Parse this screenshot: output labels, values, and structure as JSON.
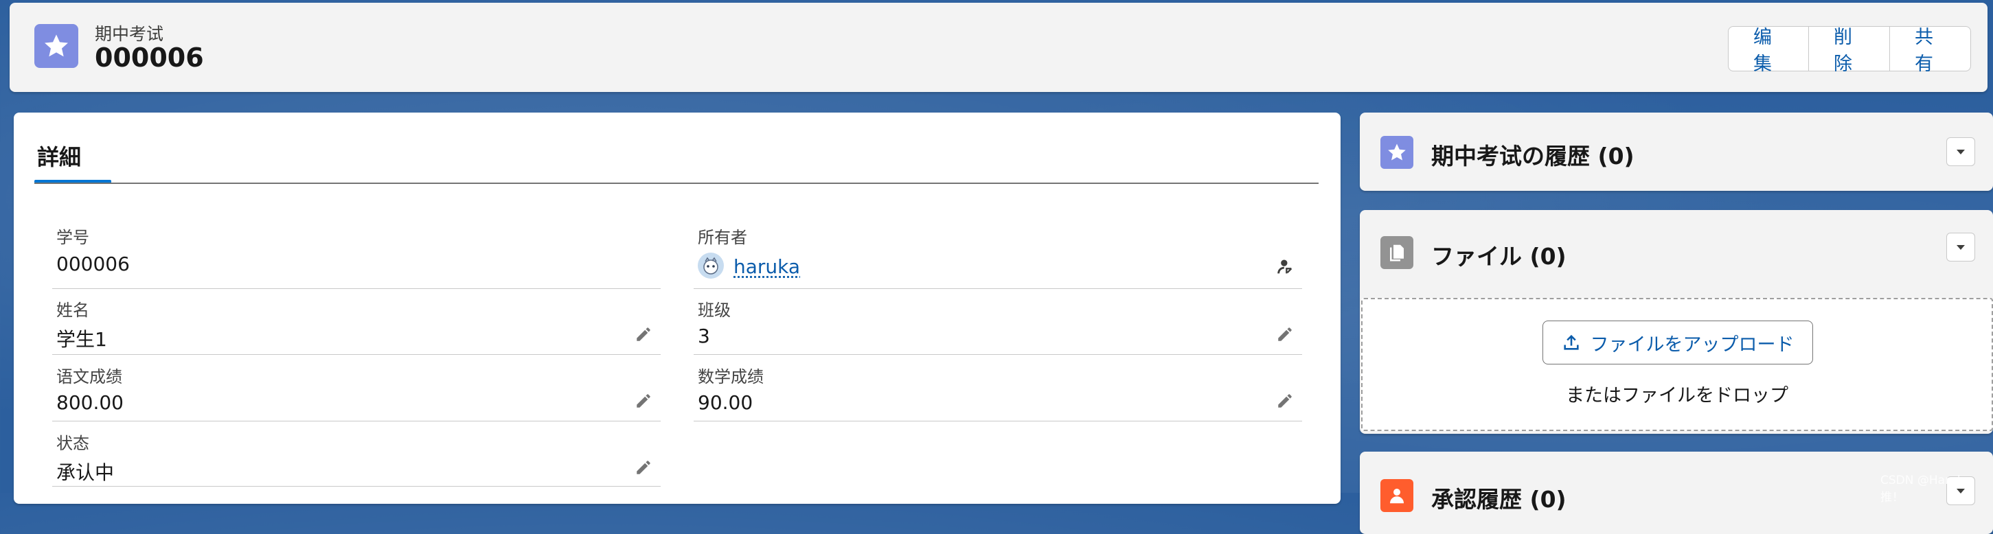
{
  "header": {
    "object_type": "期中考试",
    "record_name": "000006",
    "icon": "star-icon",
    "icon_color": "#7f8de1",
    "buttons": {
      "edit": "编集",
      "delete": "削除",
      "share": "共有"
    }
  },
  "detail": {
    "tab_label": "詳細",
    "fields": {
      "student_no": {
        "label": "学号",
        "value": "000006"
      },
      "owner": {
        "label": "所有者",
        "value": "haruka",
        "icon": "user-avatar-icon",
        "action_icon": "change-owner-icon"
      },
      "name": {
        "label": "姓名",
        "value": "学生1"
      },
      "class": {
        "label": "班级",
        "value": "3"
      },
      "chinese_score": {
        "label": "语文成绩",
        "value": "800.00"
      },
      "math_score": {
        "label": "数学成绩",
        "value": "90.00"
      },
      "status": {
        "label": "状态",
        "value": "承认中"
      }
    },
    "edit_icon": "pencil-icon"
  },
  "sidebar": {
    "history": {
      "title": "期中考试の履歴 (0)",
      "icon": "star-icon",
      "icon_color": "#7f8de1"
    },
    "files": {
      "title": "ファイル (0)",
      "icon": "file-icon",
      "icon_color": "#939393",
      "upload_label": "ファイルをアップロード",
      "drop_text": "またはファイルをドロップ"
    },
    "approval": {
      "title": "承認履歴 (0)",
      "icon": "approval-icon",
      "icon_color": "#ff5d2d"
    }
  },
  "watermark": "CSDN @Haruka推！",
  "colors": {
    "brand_blue": "#0176d3",
    "link_blue": "#0b5cab",
    "background": "#2c5f9e"
  }
}
